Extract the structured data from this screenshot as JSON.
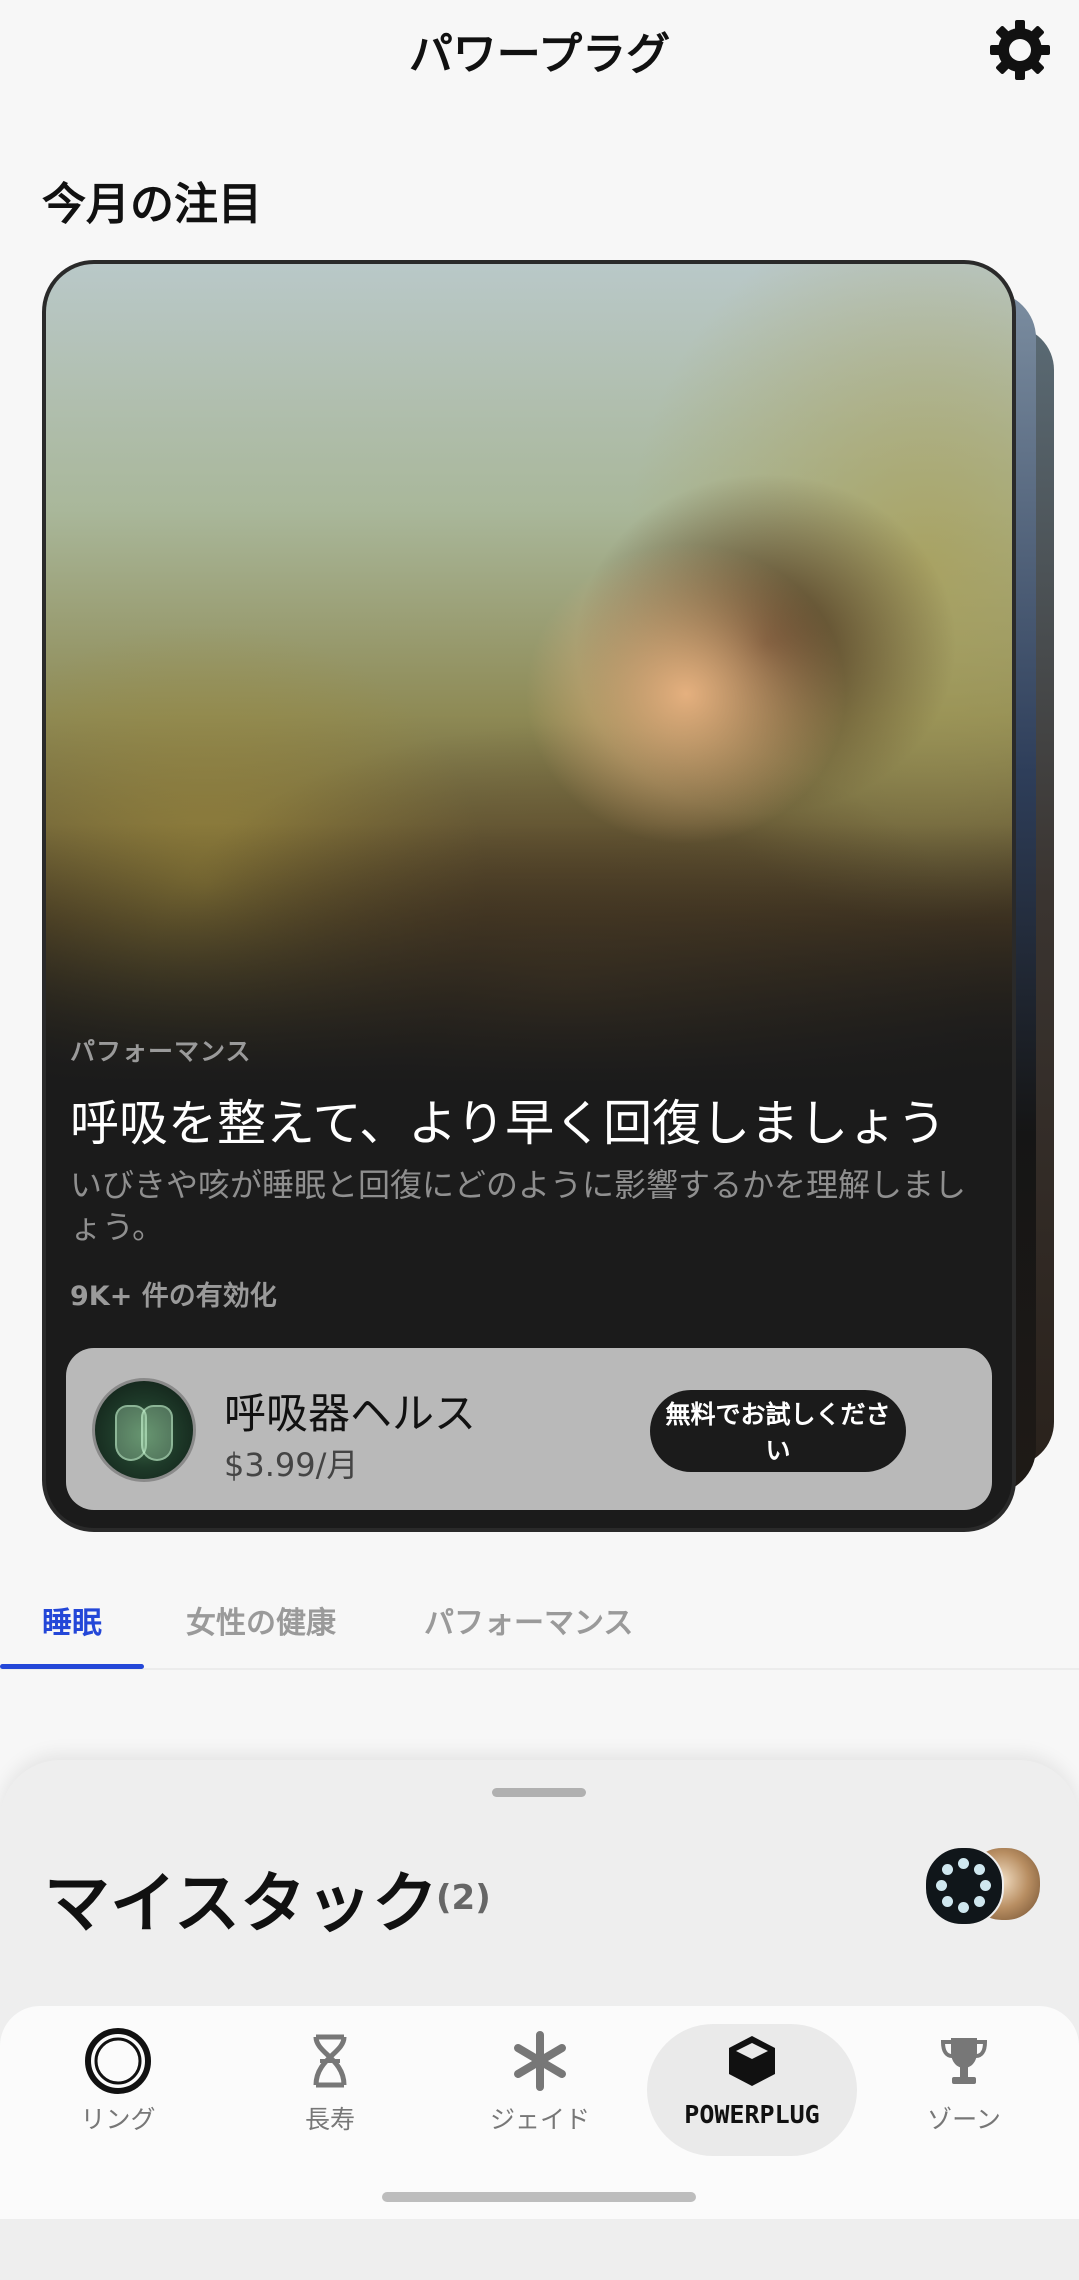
{
  "header": {
    "title": "パワープラグ"
  },
  "section": {
    "title": "今月の注目"
  },
  "featured_card": {
    "tag": "パフォーマンス",
    "heading": "呼吸を整えて、より早く回復しましょう",
    "description": "いびきや咳が睡眠と回復にどのように影響するかを理解しましょう。",
    "activations": "9K+ 件の有効化",
    "product": {
      "name": "呼吸器ヘルス",
      "price": "$3.99/月",
      "cta": "無料でお試しください"
    }
  },
  "tabs": [
    {
      "label": "睡眠",
      "active": true
    },
    {
      "label": "女性の健康",
      "active": false
    },
    {
      "label": "パフォーマンス",
      "active": false
    }
  ],
  "my_stack": {
    "title": "マイスタック",
    "count": "(2)"
  },
  "bottom_nav": [
    {
      "label": "リング",
      "icon": "ring-icon",
      "active": false
    },
    {
      "label": "長寿",
      "icon": "dna-icon",
      "active": false
    },
    {
      "label": "ジェイド",
      "icon": "asterisk-icon",
      "active": false
    },
    {
      "label": "POWERPLUG",
      "icon": "cube-icon",
      "active": true
    },
    {
      "label": "ゾーン",
      "icon": "trophy-icon",
      "active": false
    }
  ],
  "colors": {
    "accent": "#2447d8",
    "card_bg": "#1b1b1b",
    "product_bg": "#b9b9b9"
  }
}
